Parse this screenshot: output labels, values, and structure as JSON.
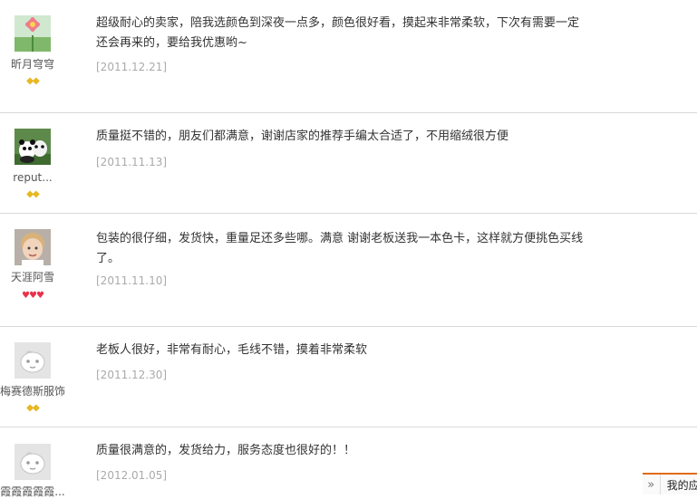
{
  "reviews": [
    {
      "username": "昕月穹穹",
      "avatar": "flower-avatar",
      "badge_type": "diamond",
      "badges": [
        "◆",
        "◆"
      ],
      "comment_lines": [
        "超级耐心的卖家，陪我选颜色到深夜一点多，颜色很好看，摸起来非常柔软，下次有需要一定",
        "还会再来的，要给我优惠哟~"
      ],
      "date": "[2011.12.21]"
    },
    {
      "username": "reput...",
      "avatar": "panda-avatar",
      "badge_type": "diamond",
      "badges": [
        "◆",
        "◆"
      ],
      "comment_lines": [
        "质量挺不错的，朋友们都满意，谢谢店家的推荐手编太合适了，不用缩绒很方便"
      ],
      "date": "[2011.11.13]"
    },
    {
      "username": "天涯阿雪",
      "avatar": "child-avatar",
      "badge_type": "heart",
      "badges": [
        "♥",
        "♥",
        "♥"
      ],
      "comment_lines": [
        "包装的很仔细，发货快，重量足还多些哪。满意 谢谢老板送我一本色卡，这样就方便挑色买线",
        "了。"
      ],
      "date": "[2011.11.10]"
    },
    {
      "username": "梅赛德斯服饰",
      "avatar": "default-avatar",
      "badge_type": "diamond",
      "badges": [
        "◆",
        "◆"
      ],
      "comment_lines": [
        "老板人很好，非常有耐心，毛线不错，摸着非常柔软"
      ],
      "date": "[2011.12.30]"
    },
    {
      "username": "霞霞霞霞霞...",
      "avatar": "default-avatar",
      "badge_type": "diamond",
      "badges": [],
      "comment_lines": [
        "质量很满意的，发货给力，服务态度也很好的！！"
      ],
      "date": "[2012.01.05]"
    }
  ],
  "float_bar": {
    "expand_glyph": "»",
    "label": "我的应"
  },
  "colors": {
    "divider": "#d9d9d9",
    "date_text": "#aaaaaa",
    "accent": "#e26a1a",
    "diamond": "#e8b820",
    "heart": "#e8324a"
  }
}
